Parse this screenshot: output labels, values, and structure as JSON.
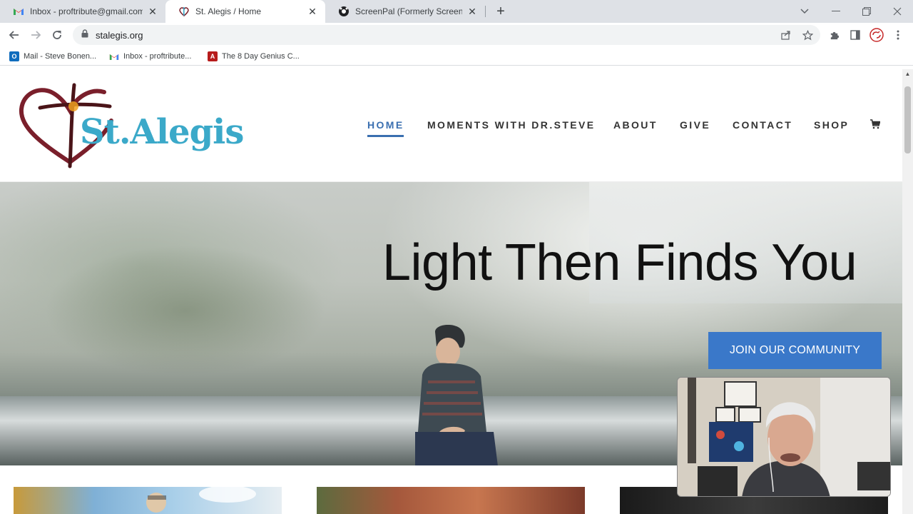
{
  "browser": {
    "tabs": [
      {
        "title": "Inbox - proftribute@gmail.com -",
        "icon": "gmail-icon",
        "active": false
      },
      {
        "title": "St. Alegis / Home",
        "icon": "st-alegis-favicon",
        "active": true
      },
      {
        "title": "ScreenPal (Formerly Screencast-O",
        "icon": "screenpal-icon",
        "active": false
      }
    ],
    "url": "stalegis.org",
    "bookmarks": [
      {
        "label": "Mail - Steve Bonen...",
        "icon": "outlook-icon"
      },
      {
        "label": "Inbox - proftribute...",
        "icon": "gmail-icon"
      },
      {
        "label": "The 8 Day Genius C...",
        "icon": "pdf-icon"
      }
    ]
  },
  "site": {
    "logo_text": "St.Alegis",
    "nav": [
      {
        "label": "HOME",
        "active": true
      },
      {
        "label": "MOMENTS WITH DR.STEVE",
        "active": false
      },
      {
        "label": "ABOUT",
        "active": false
      },
      {
        "label": "GIVE",
        "active": false
      },
      {
        "label": "CONTACT",
        "active": false
      },
      {
        "label": "SHOP",
        "active": false
      }
    ],
    "hero": {
      "title": "Light Then Finds You",
      "button": "JOIN OUR COMMUNITY"
    }
  },
  "colors": {
    "accent": "#3a78c9",
    "nav_active": "#3a6fb0",
    "logo_blue": "#3ba9c9",
    "logo_heart": "#7a1f2b"
  }
}
